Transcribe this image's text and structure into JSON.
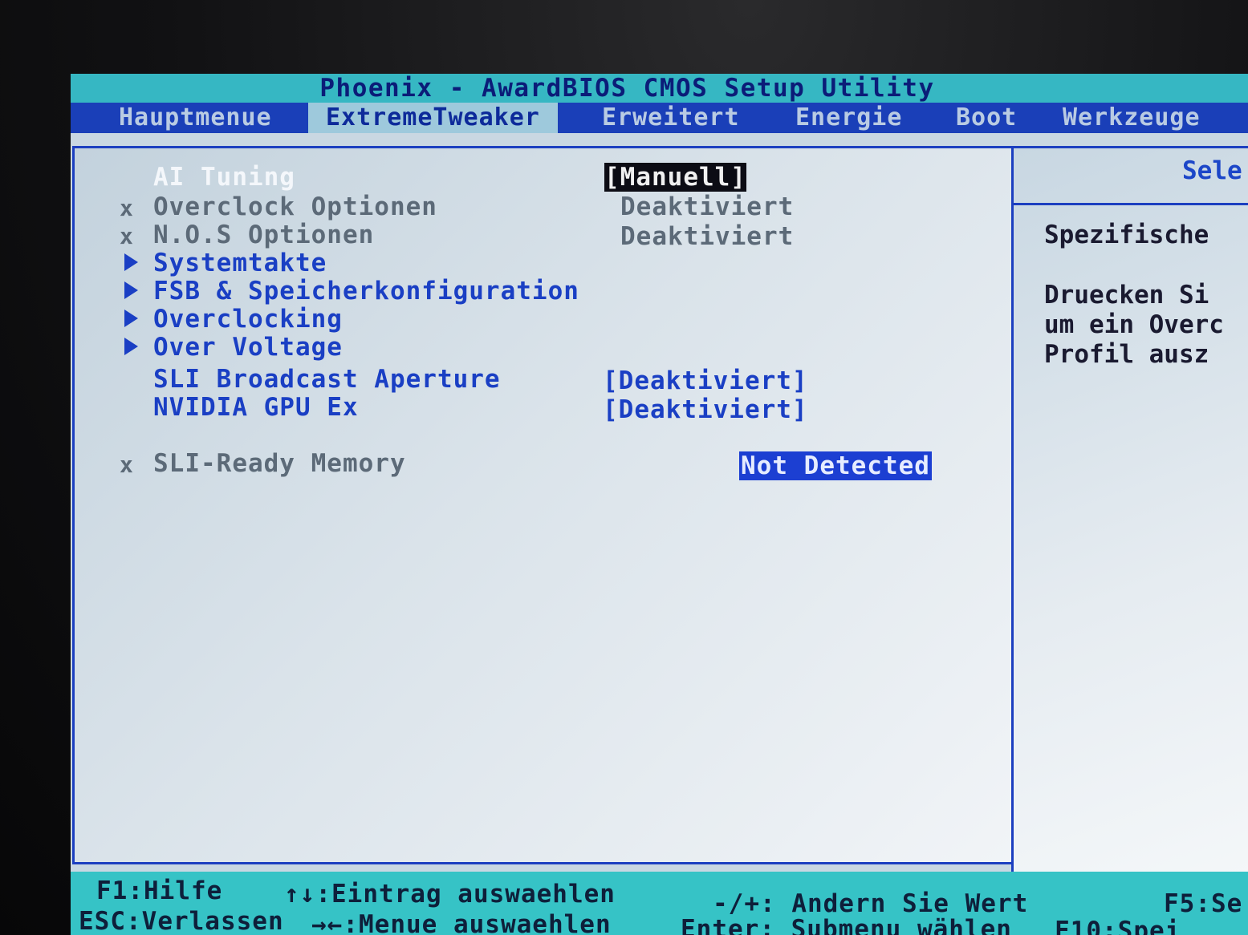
{
  "header": {
    "title": "Phoenix - AwardBIOS CMOS Setup Utility"
  },
  "tabs": [
    {
      "label": "Hauptmenue",
      "active": false
    },
    {
      "label": "ExtremeTweaker",
      "active": true
    },
    {
      "label": "Erweitert",
      "active": false
    },
    {
      "label": "Energie",
      "active": false
    },
    {
      "label": "Boot",
      "active": false
    },
    {
      "label": "Werkzeuge",
      "active": false
    }
  ],
  "settings": [
    {
      "label": "AI Tuning",
      "value": "[Manuell]",
      "state": "selected",
      "marker": ""
    },
    {
      "label": "Overclock Optionen",
      "value": "Deaktiviert",
      "state": "disabled",
      "marker": "x"
    },
    {
      "label": "N.O.S Optionen",
      "value": "Deaktiviert",
      "state": "disabled",
      "marker": "x"
    },
    {
      "label": "Systemtakte",
      "value": "",
      "state": "submenu",
      "marker": "submenu-arrow-icon"
    },
    {
      "label": "FSB & Speicherkonfiguration",
      "value": "",
      "state": "submenu",
      "marker": "submenu-arrow-icon"
    },
    {
      "label": "Overclocking",
      "value": "",
      "state": "submenu",
      "marker": "submenu-arrow-icon"
    },
    {
      "label": "Over Voltage",
      "value": "",
      "state": "submenu",
      "marker": "submenu-arrow-icon"
    },
    {
      "label": "SLI Broadcast Aperture",
      "value": "[Deaktiviert]",
      "state": "enabled",
      "marker": ""
    },
    {
      "label": "NVIDIA GPU Ex",
      "value": "[Deaktiviert]",
      "state": "enabled",
      "marker": ""
    },
    {
      "label": "SLI-Ready Memory",
      "value": "Not Detected",
      "state": "disabled",
      "marker": "x"
    }
  ],
  "help": {
    "title": "Sele",
    "lines": [
      "Spezifische",
      "Druecken Si",
      "um ein Overc",
      "Profil ausz"
    ]
  },
  "footer": {
    "f1": "F1:Hilfe",
    "updown": "↑↓:Eintrag auswaehlen",
    "plusminus": "-/+: Andern Sie Wert",
    "f5": "F5:Se",
    "esc": "ESC:Verlassen",
    "leftright": "→←:Menue auswaehlen",
    "enter": "Enter: Submenu wählen",
    "f10": "F10:Spei"
  },
  "colors": {
    "title_bar": "#36b7c3",
    "tab_bar": "#1a3fb8",
    "active_tab": "#9ec9dc",
    "text_blue": "#1a3fc4",
    "text_gray": "#5c6a78",
    "selection_blue": "#1c3fd2",
    "footer_bg": "#36c3c6"
  }
}
